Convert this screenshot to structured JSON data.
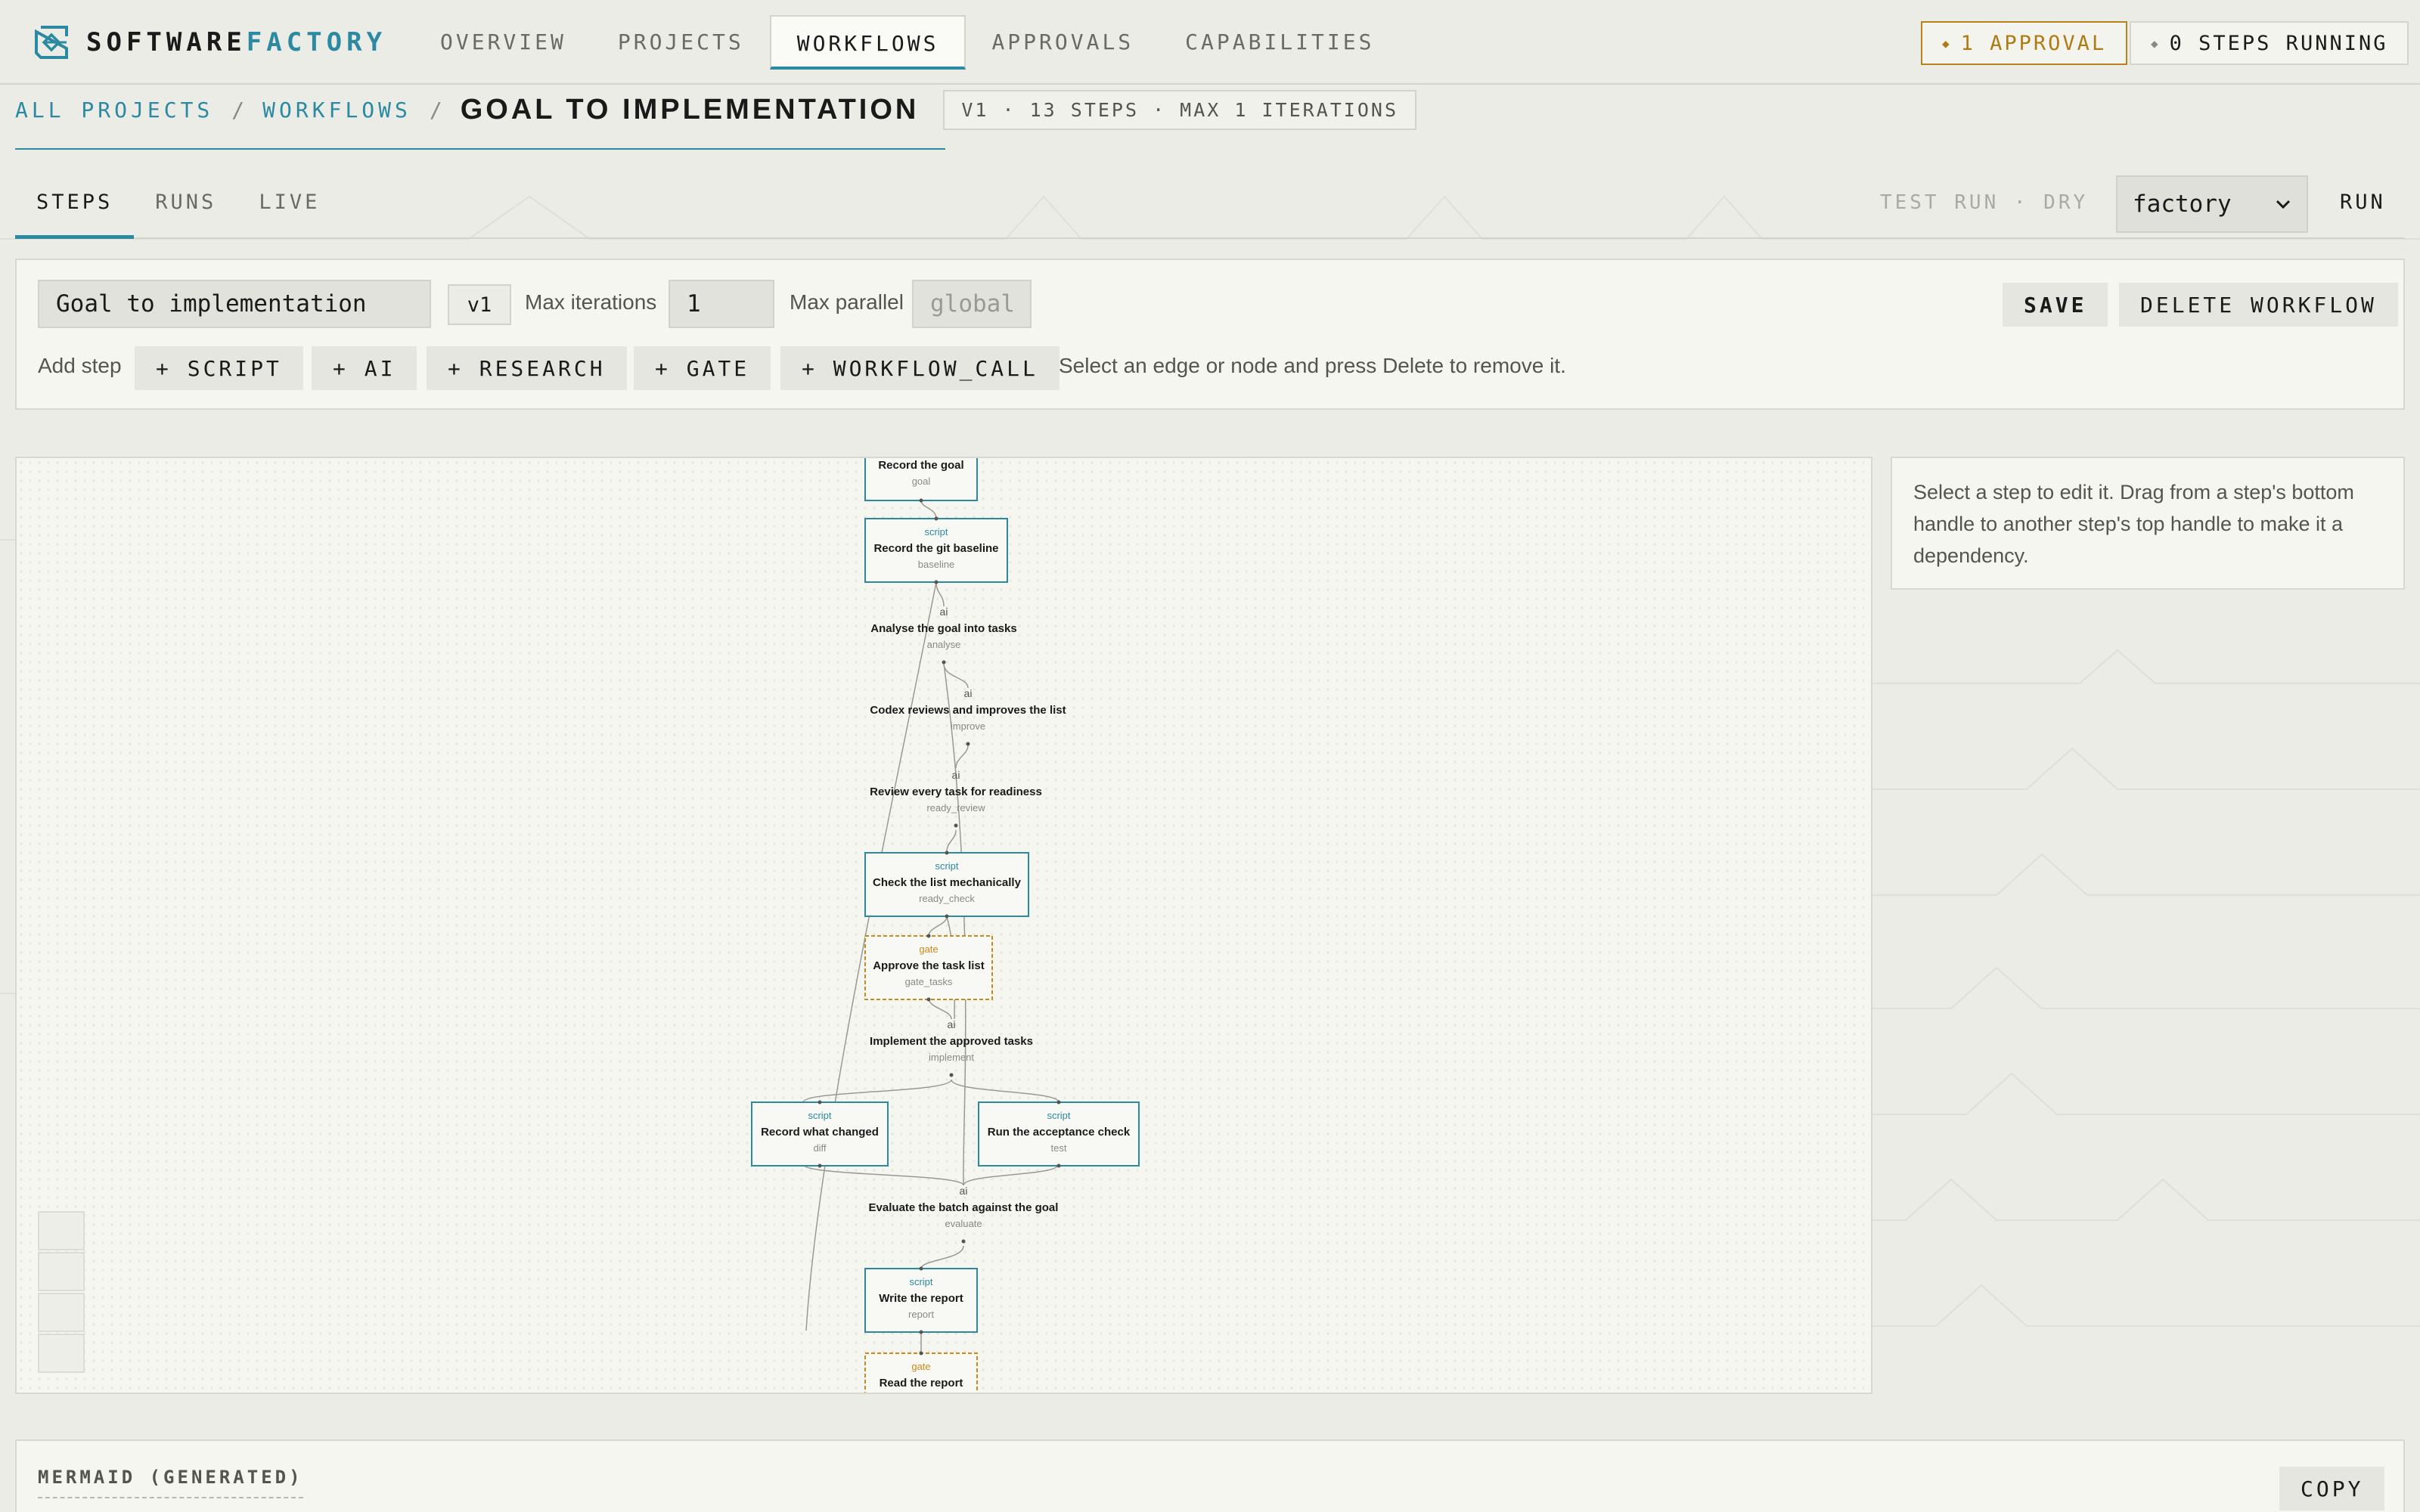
{
  "brand": {
    "name_part1": "SOFTWARE",
    "name_part2": "FACTORY"
  },
  "nav": {
    "items": [
      {
        "label": "OVERVIEW",
        "active": false
      },
      {
        "label": "PROJECTS",
        "active": false
      },
      {
        "label": "WORKFLOWS",
        "active": true
      },
      {
        "label": "APPROVALS",
        "active": false
      },
      {
        "label": "CAPABILITIES",
        "active": false
      }
    ],
    "approvals_pill": "1 APPROVAL",
    "steps_pill": "0 STEPS RUNNING"
  },
  "breadcrumb": {
    "all_projects": "ALL PROJECTS",
    "sep": "/",
    "workflows": "WORKFLOWS",
    "title": "GOAL TO IMPLEMENTATION",
    "meta": "V1 · 13 STEPS · MAX 1 ITERATIONS"
  },
  "tabs": {
    "items": [
      {
        "label": "STEPS",
        "active": true
      },
      {
        "label": "RUNS",
        "active": false
      },
      {
        "label": "LIVE",
        "active": false
      }
    ],
    "test_run": "TEST RUN · DRY",
    "env_value": "factory",
    "run_label": "RUN"
  },
  "editor": {
    "name_value": "Goal to implementation",
    "version": "v1",
    "max_iterations_label": "Max iterations",
    "max_iterations_value": "1",
    "max_parallel_label": "Max parallel",
    "max_parallel_placeholder": "global",
    "save_label": "SAVE",
    "delete_label": "DELETE WORKFLOW",
    "add_step_label": "Add step",
    "add_buttons": [
      "+ SCRIPT",
      "+ AI",
      "+ RESEARCH",
      "+ GATE",
      "+ WORKFLOW_CALL"
    ],
    "hint": "Select an edge or node and press Delete to remove it."
  },
  "graph": {
    "steps": [
      {
        "kind": "",
        "title": "Record the goal",
        "id": "goal",
        "style": "script"
      },
      {
        "kind": "script",
        "title": "Record the git baseline",
        "id": "baseline",
        "style": "script"
      },
      {
        "kind": "ai",
        "title": "Analyse the goal into tasks",
        "id": "analyse",
        "style": "ai"
      },
      {
        "kind": "ai",
        "title": "Codex reviews and improves the list",
        "id": "improve",
        "style": "ai"
      },
      {
        "kind": "ai",
        "title": "Review every task for readiness",
        "id": "ready_review",
        "style": "ai"
      },
      {
        "kind": "script",
        "title": "Check the list mechanically",
        "id": "ready_check",
        "style": "script"
      },
      {
        "kind": "gate",
        "title": "Approve the task list",
        "id": "gate_tasks",
        "style": "gate"
      },
      {
        "kind": "ai",
        "title": "Implement the approved tasks",
        "id": "implement",
        "style": "ai"
      },
      {
        "kind": "script",
        "title": "Record what changed",
        "id": "diff",
        "style": "script"
      },
      {
        "kind": "script",
        "title": "Run the acceptance check",
        "id": "test",
        "style": "script"
      },
      {
        "kind": "ai",
        "title": "Evaluate the batch against the goal",
        "id": "evaluate",
        "style": "ai"
      },
      {
        "kind": "script",
        "title": "Write the report",
        "id": "report",
        "style": "script"
      },
      {
        "kind": "gate",
        "title": "Read the report",
        "id": "",
        "style": "gate"
      }
    ],
    "colors": {
      "script": "#2b8aa2",
      "gate": "#c98a1c",
      "edge": "#9a9a94"
    }
  },
  "side_panel": {
    "text": "Select a step to edit it. Drag from a step's bottom handle to another step's top handle to make it a dependency."
  },
  "mermaid": {
    "title": "MERMAID (GENERATED)",
    "copy_label": "COPY"
  }
}
